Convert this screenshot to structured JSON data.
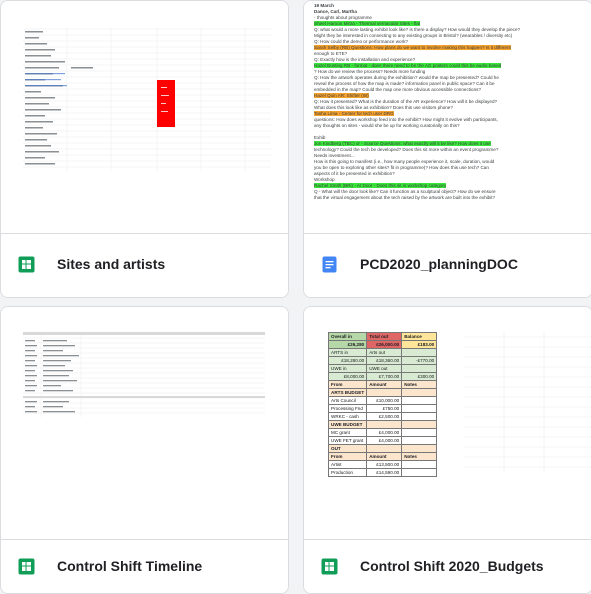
{
  "files": [
    {
      "title": "Sites and artists",
      "type": "spreadsheet",
      "icon": "sheets-icon"
    },
    {
      "title": "PCD2020_planningDOC",
      "type": "document",
      "icon": "docs-icon"
    },
    {
      "title": "Control Shift Timeline",
      "type": "spreadsheet",
      "icon": "sheets-icon"
    },
    {
      "title": "Control Shift 2020_Budgets",
      "type": "spreadsheet",
      "icon": "sheets-icon"
    }
  ],
  "doc_preview": {
    "lines": [
      "19 March",
      "Dance, Carl, Martha",
      "- thoughts about programme",
      "Sheet Haroon Mirza - Thermal vernacular Sites - flat",
      "Q: what would a more lasting exhibit look like? is there a display? How would they develop the piece?",
      "Might they be interested in connecting to any existing groups in Bristol? (wearables / diversity etc)",
      "Q: How could the demo or performance work?",
      "Sarah Selby (RB) Questions: How plans do we want to involve making this happen? Is it different",
      "enough to ETE?",
      "Q: Exactly how is the installation and experience?",
      "Hazel Bunting RB - format - does there need to be the AG posters could this be audio based",
      "? How do we review the process? Needs more funding",
      "Q: How the artwork operates during the exhibition? would the map be presented? Could he",
      "reveal the process of how the map is made? information panel in public space? Can it be",
      "embedded in the map? Could the map one more obvious accessible connections?",
      "Hazel Quin AR: Shifter (W)",
      "Q: How it presented? What is the duration of the AR experience? How will it be displayed?",
      "What does this look like as exhibition? Does this use visitors phone?",
      "Tasha Lima - Center for tech user DRG",
      "questions: How does workshop feed into the exhibit? How might it evolve with participants,",
      "any thoughts on sites - would she be up for working curatorially on this?",
      "",
      "Exhib",
      "Jon Kindberg (TBC) or - Source Questions: what exactly will it be like? How does it use",
      "technology? Could the tech be developed? Does this sit more within an event programme?",
      "Needs investment...",
      "How is this going to manifest (i.e., how many people experience it, scale, duration, would",
      "you be open to exploring other sites? fit in programme)? How does this use tech? Can",
      "aspects of it be presented in exhibition?",
      "Workshop",
      "Rachel Smith (BRi) - At Door - Does this sit in workshop category",
      "Q - What will the door look like? Can it function as a sculptural object? How do we ensure",
      "that the virtual engagement about the tech raised by the artwork are built into the exhibit?"
    ]
  },
  "budget_preview": {
    "header": [
      [
        "Overall in",
        "Total out",
        "Balance"
      ],
      [
        "£26,280",
        "£26,000.00",
        "£183.00"
      ]
    ],
    "rows": [
      [
        "ARTS in",
        "Arts out",
        ""
      ],
      [
        "£18,280.00",
        "£18,360.00",
        "-£770.00"
      ],
      [
        "UWE in",
        "UWE out",
        ""
      ],
      [
        "£8,000.00",
        "£7,700.00",
        "£300.00"
      ],
      [
        "From",
        "Amount",
        "Notes"
      ],
      [
        "ARTS BUDGET",
        "",
        ""
      ],
      [
        "Arts Council",
        "£10,000.00",
        ""
      ],
      [
        "Processing Fnd",
        "£750.00",
        ""
      ],
      [
        "WRKC - cash",
        "£2,500.00",
        ""
      ],
      [
        "UWE BUDGET",
        "",
        ""
      ],
      [
        "MC grant",
        "£4,000.00",
        ""
      ],
      [
        "UWE FET grant",
        "£4,000.00",
        ""
      ],
      [
        "OUT",
        "",
        ""
      ],
      [
        "From",
        "Amount",
        "Notes"
      ],
      [
        "Artist",
        "£13,500.00",
        ""
      ],
      [
        "Production",
        "£14,590.00",
        ""
      ]
    ]
  },
  "colors": {
    "sheets_green": "#0f9d58",
    "docs_blue": "#4285f4",
    "highlight_green": "#39e639",
    "highlight_orange": "#f5a12c",
    "budget_green": "#b6d7a8",
    "budget_red": "#e06666",
    "budget_yellow": "#ffe599",
    "budget_peach": "#fce5cd"
  }
}
